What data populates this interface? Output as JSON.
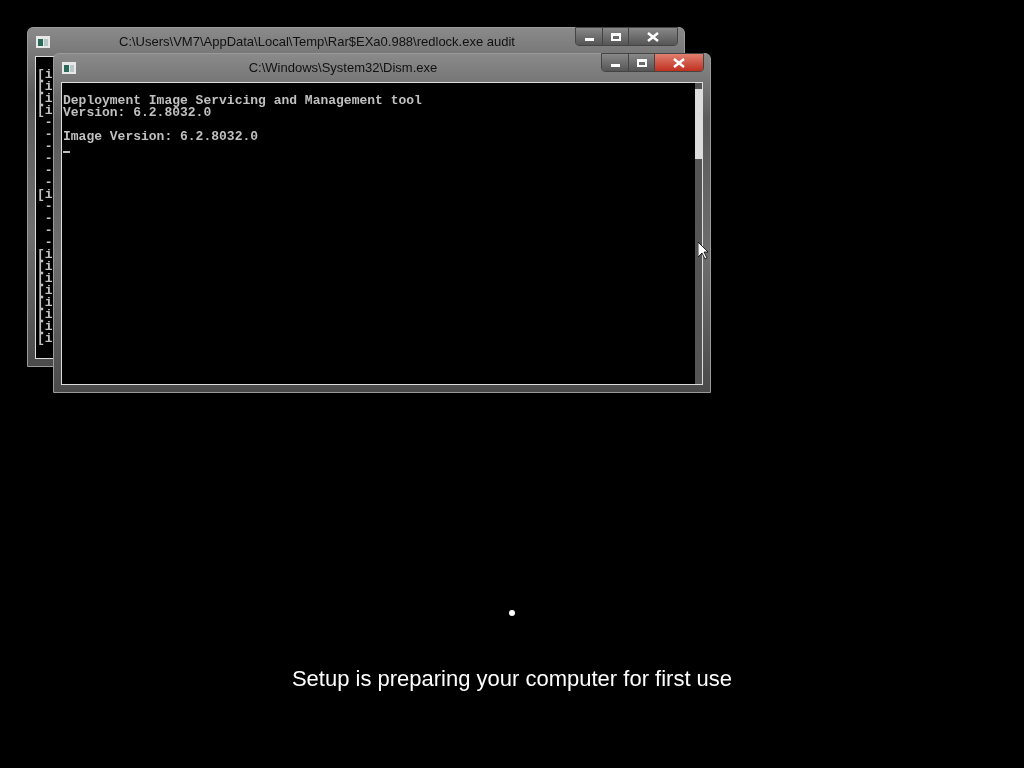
{
  "windows": [
    {
      "title": "C:\\Users\\VM7\\AppData\\Local\\Temp\\Rar$EXa0.988\\redlock.exe audit",
      "active": false,
      "blocks": [
        [
          "[i",
          "[i",
          "[i",
          "[i",
          " -",
          " -",
          " -",
          " -",
          " -",
          " -",
          "[i",
          " -",
          " -",
          " -",
          " -",
          "[i",
          "[i",
          "[i",
          "[i",
          "[i",
          "[i",
          "[i",
          "[i"
        ]
      ]
    },
    {
      "title": "C:\\Windows\\System32\\Dism.exe",
      "active": true,
      "blocks": [
        [
          "Deployment Image Servicing and Management tool",
          "Version: 6.2.8032.0"
        ],
        [
          "Image Version: 6.2.8032.0"
        ]
      ]
    }
  ],
  "setup": {
    "message": "Setup is preparing your computer for first use"
  }
}
